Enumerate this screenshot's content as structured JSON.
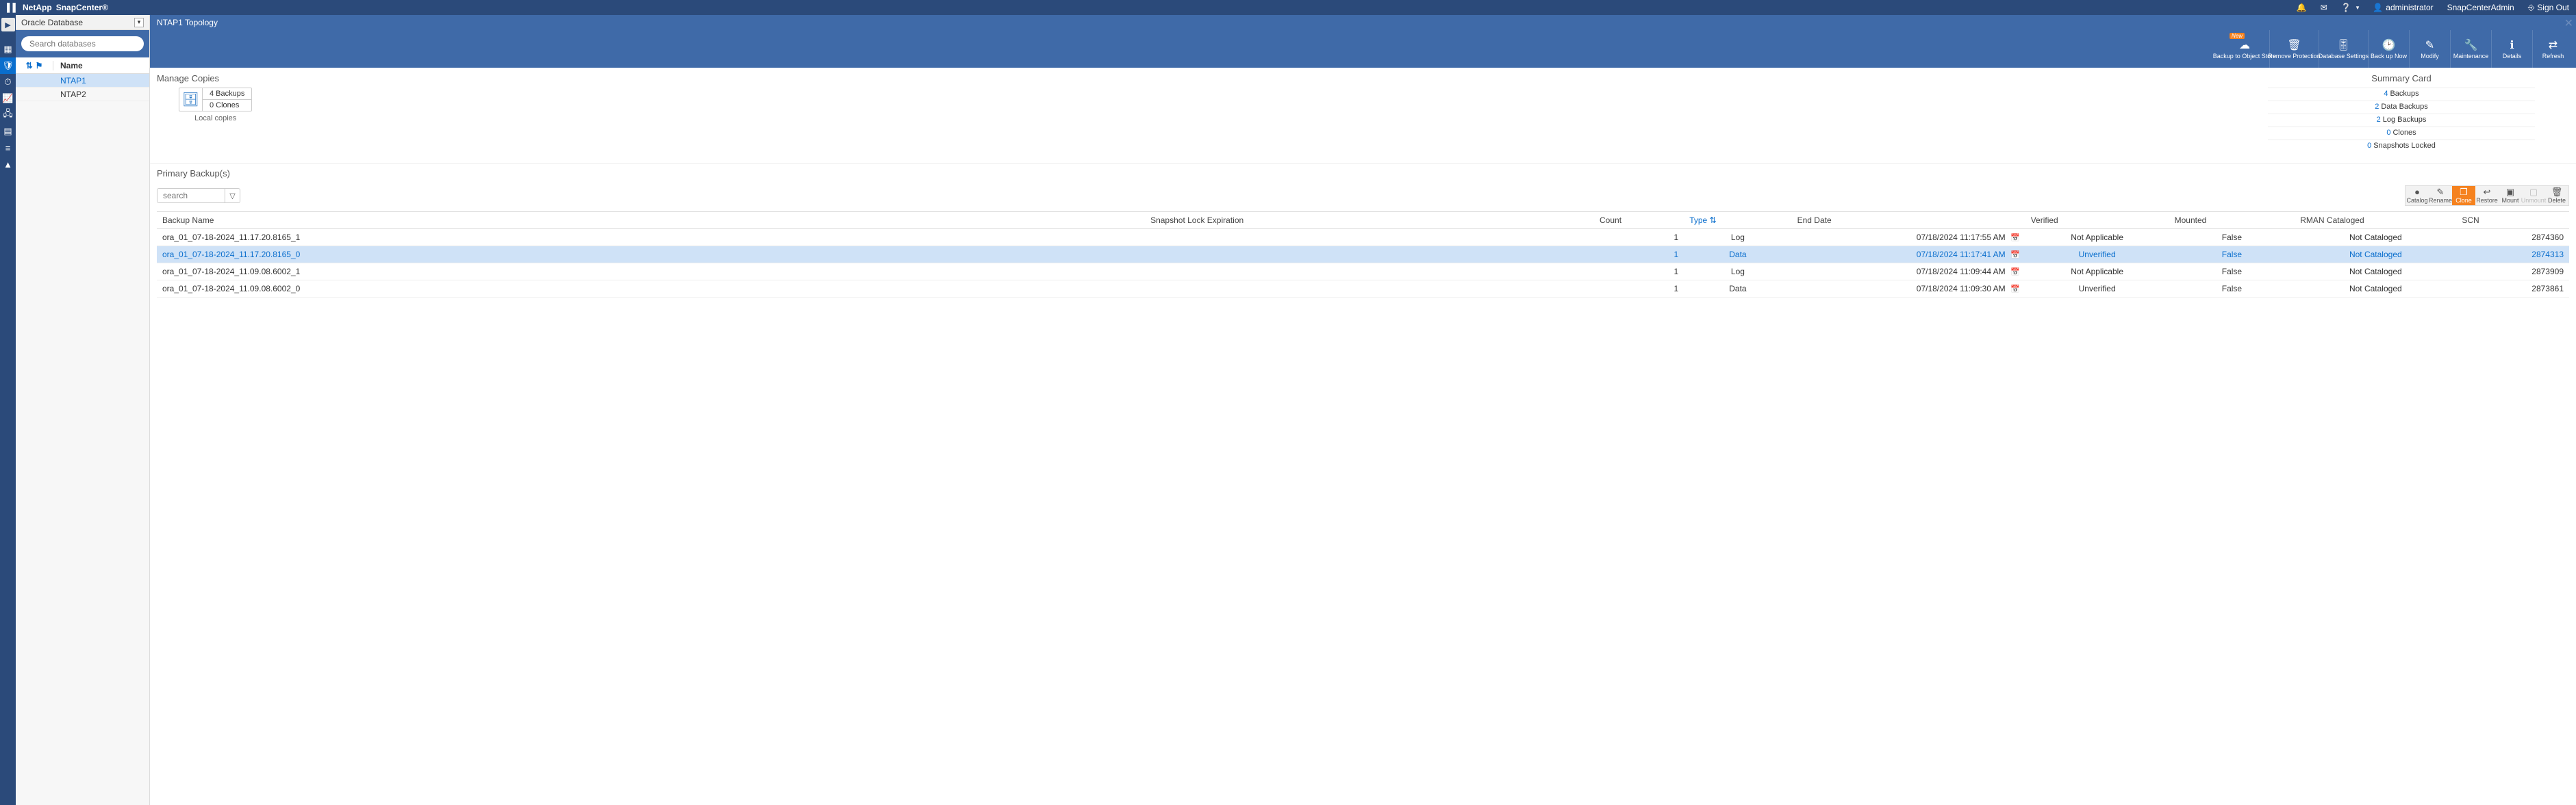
{
  "brand": {
    "company": "NetApp",
    "product": "SnapCenter®"
  },
  "topbar": {
    "user": "administrator",
    "role": "SnapCenterAdmin",
    "signout": "Sign Out"
  },
  "sidebar": {
    "context_label": "Oracle Database",
    "search_placeholder": "Search databases",
    "name_header": "Name",
    "items": [
      "NTAP1",
      "NTAP2"
    ],
    "selected_index": 0
  },
  "breadcrumb": "NTAP1 Topology",
  "toolbar": [
    {
      "label": "Backup to Object Store",
      "icon": "cloud",
      "new": true
    },
    {
      "label": "Remove Protection",
      "icon": "trash"
    },
    {
      "label": "Database Settings",
      "icon": "sliders"
    },
    {
      "label": "Back up Now",
      "icon": "clock"
    },
    {
      "label": "Modify",
      "icon": "pencil"
    },
    {
      "label": "Maintenance",
      "icon": "wrench"
    },
    {
      "label": "Details",
      "icon": "info"
    },
    {
      "label": "Refresh",
      "icon": "refresh"
    }
  ],
  "manage_copies": {
    "title": "Manage Copies",
    "backups_line": "4 Backups",
    "clones_line": "0 Clones",
    "caption": "Local copies"
  },
  "summary": {
    "title": "Summary Card",
    "lines": [
      {
        "num": "4",
        "text": "Backups"
      },
      {
        "num": "2",
        "text": "Data Backups"
      },
      {
        "num": "2",
        "text": "Log Backups"
      },
      {
        "num": "0",
        "text": "Clones"
      },
      {
        "num": "0",
        "text": "Snapshots Locked"
      }
    ]
  },
  "primary": {
    "title": "Primary Backup(s)",
    "search_placeholder": "search",
    "mini_tools": [
      {
        "label": "Catalog",
        "icon": "●"
      },
      {
        "label": "Rename",
        "icon": "✎"
      },
      {
        "label": "Clone",
        "icon": "❐",
        "active": true
      },
      {
        "label": "Restore",
        "icon": "↩"
      },
      {
        "label": "Mount",
        "icon": "▣"
      },
      {
        "label": "Unmount",
        "icon": "▢",
        "disabled": true
      },
      {
        "label": "Delete",
        "icon": "🗑"
      }
    ],
    "columns": {
      "name": "Backup Name",
      "snap": "Snapshot Lock Expiration",
      "count": "Count",
      "type": "Type",
      "end": "End Date",
      "verified": "Verified",
      "mounted": "Mounted",
      "rman": "RMAN Cataloged",
      "scn": "SCN"
    },
    "rows": [
      {
        "name": "ora_01_07-18-2024_11.17.20.8165_1",
        "snap": "",
        "count": "1",
        "type": "Log",
        "end": "07/18/2024 11:17:55 AM",
        "verified": "Not Applicable",
        "mounted": "False",
        "rman": "Not Cataloged",
        "scn": "2874360"
      },
      {
        "name": "ora_01_07-18-2024_11.17.20.8165_0",
        "snap": "",
        "count": "1",
        "type": "Data",
        "end": "07/18/2024 11:17:41 AM",
        "verified": "Unverified",
        "mounted": "False",
        "rman": "Not Cataloged",
        "scn": "2874313",
        "selected": true
      },
      {
        "name": "ora_01_07-18-2024_11.09.08.6002_1",
        "snap": "",
        "count": "1",
        "type": "Log",
        "end": "07/18/2024 11:09:44 AM",
        "verified": "Not Applicable",
        "mounted": "False",
        "rman": "Not Cataloged",
        "scn": "2873909"
      },
      {
        "name": "ora_01_07-18-2024_11.09.08.6002_0",
        "snap": "",
        "count": "1",
        "type": "Data",
        "end": "07/18/2024 11:09:30 AM",
        "verified": "Unverified",
        "mounted": "False",
        "rman": "Not Cataloged",
        "scn": "2873861"
      }
    ]
  }
}
